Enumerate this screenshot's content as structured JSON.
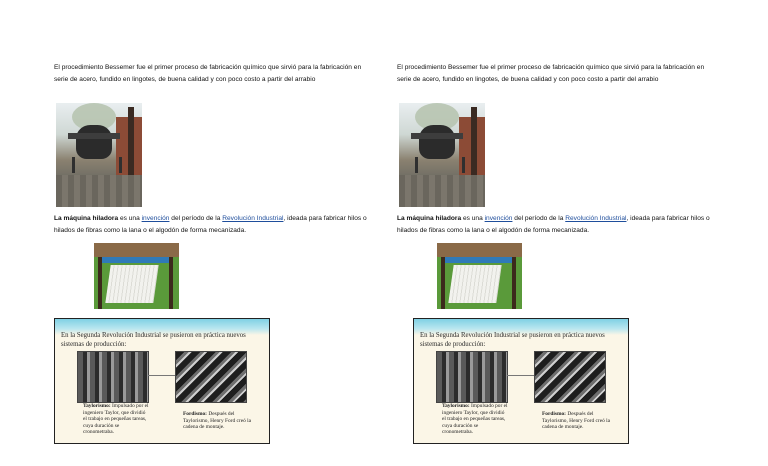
{
  "documents": [
    {
      "bessemer_text": "El procedimiento Bessemer fue el primer proceso de fabricación químico que sirvió para la fabricación en serie de acero, fundido en lingotes, de buena calidad y con poco costo a partir del arrabio",
      "spinning": {
        "bold": "La máquina hiladora",
        "t1": " es una ",
        "link1": "invención",
        "t2": " del período de la ",
        "link2": "Revolución Industrial",
        "t3": ", ideada para fabricar hilos o hilados de fibras como la lana o el algodón de forma mecanizada."
      },
      "slide": {
        "title": "En la Segunda Revolución Industrial se pusieron en práctica nuevos sistemas de producción:",
        "taylor_head": "Taylorismo:",
        "taylor_text": " Impulsado por el ingeniero Taylor, que dividió el trabajo en pequeñas tareas, cuya duración se cronometraba.",
        "ford_head": "Fordismo:",
        "ford_text": " Después del Taylorismo, Henry Ford creó la cadena de montaje."
      }
    },
    {
      "bessemer_text": "El procedimiento Bessemer fue el primer proceso de fabricación químico que sirvió para la fabricación en serie de acero, fundido en lingotes, de buena calidad y con poco costo a partir del arrabio",
      "spinning": {
        "bold": "La máquina hiladora",
        "t1": " es una ",
        "link1": "invención",
        "t2": " del período de la ",
        "link2": "Revolución Industrial",
        "t3": ", ideada para fabricar hilos o hilados de fibras como la lana o el algodón de forma mecanizada."
      },
      "slide": {
        "title": "En la Segunda Revolución Industrial se pusieron en práctica nuevos sistemas de producción:",
        "taylor_head": "Taylorismo:",
        "taylor_text": " Impulsado por el ingeniero Taylor, que dividió el trabajo en pequeñas tareas, cuya duración se cronometraba.",
        "ford_head": "Fordismo:",
        "ford_text": " Después del Taylorismo, Henry Ford creó la cadena de montaje."
      }
    }
  ],
  "colors": {
    "link": "#1f4e9c",
    "slide_bg": "#fbf6e7",
    "slide_wave": "#7fd1e4"
  }
}
